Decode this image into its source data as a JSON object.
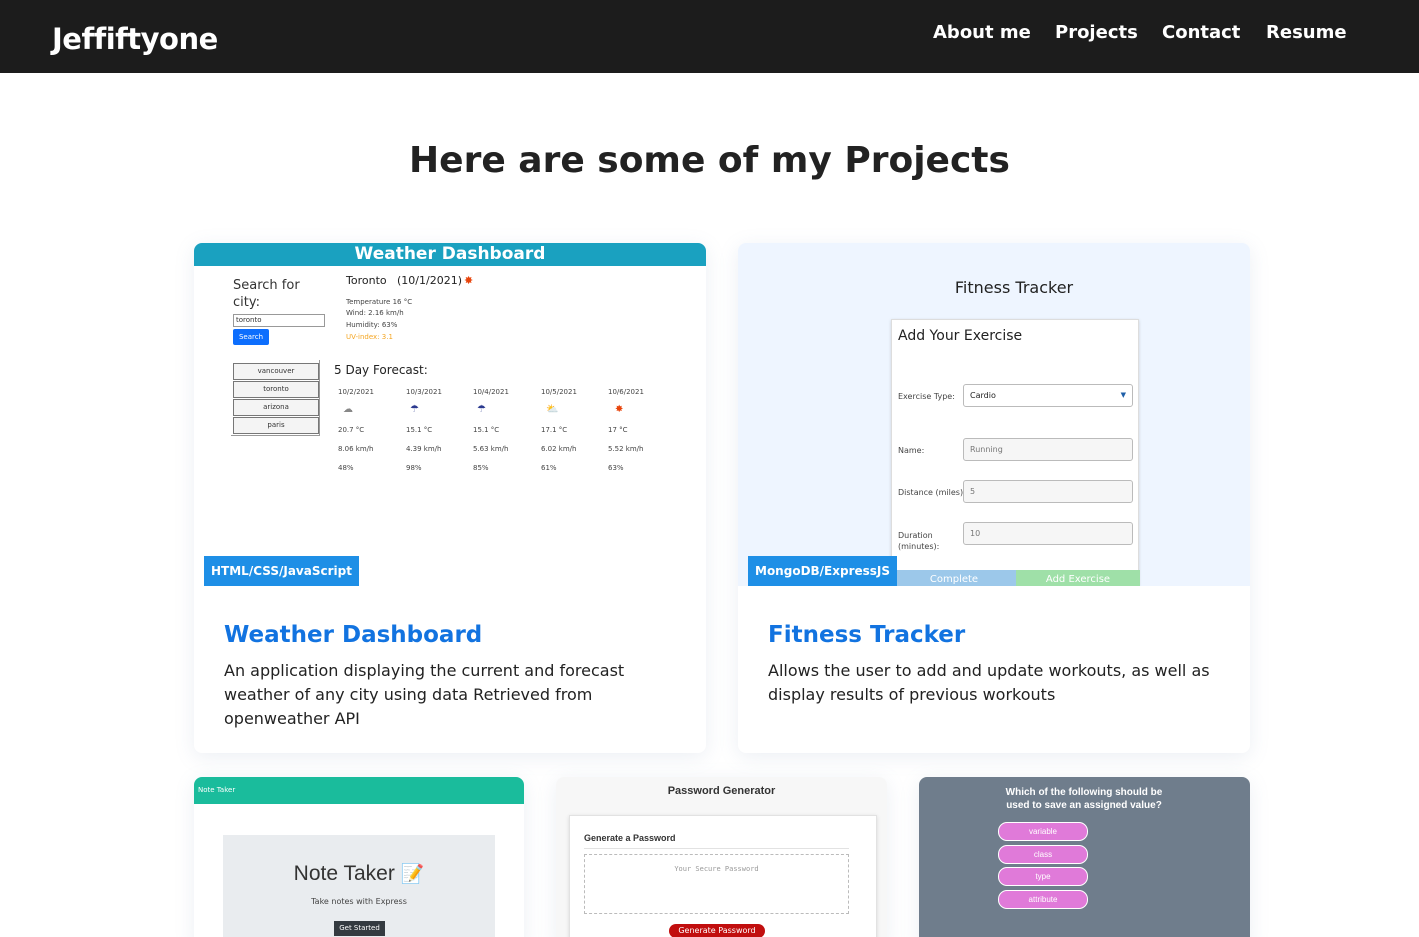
{
  "nav": {
    "brand": "Jeffiftyone",
    "links": [
      "About me",
      "Projects",
      "Contact",
      "Resume"
    ]
  },
  "page_title": "Here are some of my Projects",
  "projects": [
    {
      "title": "Weather Dashboard",
      "description": "An application displaying the current and forecast weather of any city using data Retrieved from openweather API",
      "tech": "HTML/CSS/JavaScript",
      "preview": {
        "header": "Weather Dashboard",
        "search_label": "Search for city:",
        "input_value": "toronto",
        "search_button": "Search",
        "cities": [
          "vancouver",
          "toronto",
          "arizona",
          "paris"
        ],
        "current_city": "Toronto",
        "current_date": "(10/1/2021)",
        "current_stats": [
          "Temperature 16 °C",
          "Wind: 2.16 km/h",
          "Humidity: 63%",
          "UV-index: 3.1"
        ],
        "forecast_label": "5 Day Forecast:",
        "forecast": [
          {
            "date": "10/2/2021",
            "icon": "cloud-icon",
            "temp": "20.7 °C",
            "wind": "8.06 km/h",
            "humidity": "48%"
          },
          {
            "date": "10/3/2021",
            "icon": "rain-icon",
            "temp": "15.1 °C",
            "wind": "4.39 km/h",
            "humidity": "98%"
          },
          {
            "date": "10/4/2021",
            "icon": "rain-icon",
            "temp": "15.1 °C",
            "wind": "5.63 km/h",
            "humidity": "85%"
          },
          {
            "date": "10/5/2021",
            "icon": "partly-cloudy-icon",
            "temp": "17.1 °C",
            "wind": "6.02 km/h",
            "humidity": "61%"
          },
          {
            "date": "10/6/2021",
            "icon": "sun-icon",
            "temp": "17 °C",
            "wind": "5.52 km/h",
            "humidity": "63%"
          }
        ]
      }
    },
    {
      "title": "Fitness Tracker",
      "description": "Allows the user to add and update workouts, as well as display results of previous workouts",
      "tech": "MongoDB/ExpressJS",
      "preview": {
        "app_title": "Fitness Tracker",
        "form_title": "Add Your Exercise",
        "exercise_type_label": "Exercise Type:",
        "exercise_type_value": "Cardio",
        "name_label": "Name:",
        "name_value": "Running",
        "distance_label": "Distance (miles):",
        "distance_value": "5",
        "duration_label": "Duration (minutes):",
        "duration_value": "10",
        "complete_button": "Complete",
        "add_button": "Add Exercise"
      }
    },
    {
      "preview": {
        "header": "Note Taker",
        "title": "Note Taker",
        "subtitle": "Take notes with Express",
        "button": "Get Started"
      }
    },
    {
      "preview": {
        "title": "Password Generator",
        "box_title": "Generate a Password",
        "placeholder": "Your Secure Password",
        "button": "Generate Password"
      }
    },
    {
      "preview": {
        "question": "Which of the following should be used to save an assigned value?",
        "options": [
          "variable",
          "class",
          "type",
          "attribute"
        ]
      }
    }
  ],
  "colors": {
    "navbar": "#1c1c1c",
    "accent_link": "#1273e0",
    "tech_badge": "#1e8fe6",
    "weather_header": "#1aa1c0",
    "note_header": "#1abc9c",
    "quiz_bg": "#6f7d8c",
    "quiz_option": "#e07ad9",
    "password_button": "#c10e0e"
  }
}
